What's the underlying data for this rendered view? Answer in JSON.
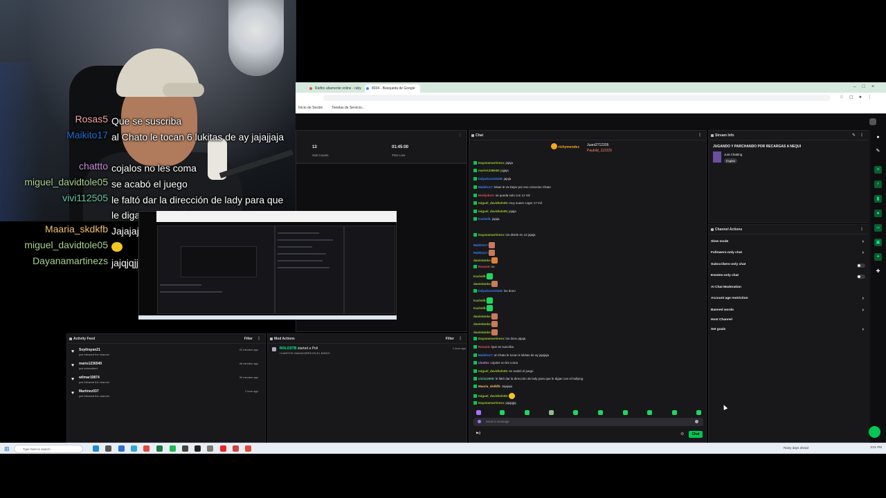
{
  "overlay_chat": [
    {
      "name": "Rosas5",
      "color": "#f5a3a3",
      "message": "Que se suscriba",
      "wrap": false
    },
    {
      "name": "Maikito17",
      "color": "#1f6fd1",
      "message": "al Chato le tocan 6 lukitas de ay jajajjaja",
      "wrap": true
    },
    {
      "name": "chattto",
      "color": "#c78ad9",
      "message": "cojalos no les coma",
      "wrap": false
    },
    {
      "name": "miguel_davidtole05",
      "color": "#a9d08e",
      "message": "se acabó el juego",
      "wrap": false
    },
    {
      "name": "vivi112505",
      "color": "#68c6a0",
      "message": "le faltó dar la dirección de lady para que le digan con el bullying",
      "wrap": true
    },
    {
      "name": "Maaria_skdkfb",
      "color": "#f4c06e",
      "message": "Jajajaja",
      "wrap": false
    },
    {
      "name": "miguel_davidtole05",
      "color": "#a9d08e",
      "message": "",
      "emote": true,
      "wrap": false
    },
    {
      "name": "Dayanamartinezs",
      "color": "#a9d08e",
      "message": "jajqjqjjq",
      "wrap": false
    }
  ],
  "browser": {
    "tabs": [
      "Rañito altamente online - ruby",
      "8034 - Búsqueda de Google"
    ],
    "bookmarks": [
      "Inicio de Sesión",
      "Tiendas de Servicio..."
    ]
  },
  "stats": {
    "subs_value": "13",
    "subs_label": "Sub Counts",
    "time_value": "01:45:00",
    "time_label": "Time Live"
  },
  "activity_feed": {
    "title": "Activity Feed",
    "filter": "Filter",
    "items": [
      {
        "name": "Soyilrayan21",
        "sub": "just followed the channel",
        "time": "22 minutes ago"
      },
      {
        "name": "mario1236549",
        "sub": "just subscribed",
        "time": "46 minutes ago"
      },
      {
        "name": "wilmar10874",
        "sub": "just followed the channel",
        "time": "30 minutes ago"
      },
      {
        "name": "Martinez037",
        "sub": "just followed the channel",
        "time": "1 hour ago"
      }
    ]
  },
  "mod_actions": {
    "title": "Mod Actions",
    "filter": "Filter",
    "item_user": "ROLOSTB",
    "item_action": "started a Poll",
    "item_sub": "CUANTOS GANADORES EN EL BINGO",
    "item_time": "1 hour ago"
  },
  "chat": {
    "title": "Chat",
    "pinned_top": "richymendez",
    "pinned_users": [
      "Juani2712205",
      "Paubild_112329"
    ],
    "input_placeholder": "Send a message",
    "send_label": "Chat",
    "points": "0",
    "lines": [
      {
        "name": "Dayanamartinezs:",
        "color": "#9acd32",
        "text": "jajaja"
      },
      {
        "name": "mario1236549:",
        "color": "#9acd32",
        "text": "jajjaja"
      },
      {
        "name": "ladyalvarez0428:",
        "color": "#3b82f6",
        "text": "jajaja"
      },
      {
        "name": "Maikito17:",
        "color": "#3b82f6",
        "text": "lukas le va Dejar por eso conocios Chato"
      },
      {
        "name": "Heidyduro:",
        "color": "#e05555",
        "text": "se queda solo con 12 mil"
      },
      {
        "name": "miguel_davidtole05:",
        "color": "#9acd32",
        "text": "muy suave coger 17 mil"
      },
      {
        "name": "miguel_davidtole05:",
        "color": "#9acd32",
        "text": "jajaja"
      },
      {
        "name": "Kachelb:",
        "color": "#3b82f6",
        "text": "jajaja"
      },
      {
        "name": "Dayanamartinezs:",
        "color": "#9acd32",
        "text": "los divide en 12 jajaja"
      },
      {
        "name": "Rosas5:",
        "color": "#e05555",
        "text": "no"
      },
      {
        "name": "ladyalvarez0428:",
        "color": "#3b82f6",
        "text": "los dono"
      },
      {
        "name": "Dayanamartinezs:",
        "color": "#9acd32",
        "text": "los dono jajaja"
      },
      {
        "name": "Rosas5:",
        "color": "#e05555",
        "text": "Que se suscriba"
      },
      {
        "name": "Maikito17:",
        "color": "#3b82f6",
        "text": "al Chato le tocan 6 lukitas de ay jajajaja"
      },
      {
        "name": "chattto:",
        "color": "#c78ad9",
        "text": "cojalos no les coma"
      },
      {
        "name": "miguel_davidtole05:",
        "color": "#9acd32",
        "text": "se acabó el juego"
      },
      {
        "name": "vivi112505:",
        "color": "#68c6a0",
        "text": "le faltó dar la dirección de lady para que le digan con el bullying"
      },
      {
        "name": "Maaria_skdkfb:",
        "color": "#f4c06e",
        "text": "Jajajaja"
      },
      {
        "name": "miguel_davidtole05:",
        "color": "#9acd32",
        "text": ""
      },
      {
        "name": "Dayanamartinezs:",
        "color": "#9acd32",
        "text": "jajqjqjjq"
      }
    ]
  },
  "stream_info": {
    "title": "Stream Info",
    "stream_title": "JUGANDO Y PARCHANDO POR RECARGAS A NEQUI",
    "category": "Just Chatting",
    "tag": "English"
  },
  "channel_actions": {
    "title": "Channel Actions",
    "items": [
      {
        "label": "Slow mode",
        "control": "chevron"
      },
      {
        "label": "Followers-only chat",
        "control": "chevron"
      },
      {
        "label": "Subscribers-only chat",
        "control": "toggle"
      },
      {
        "label": "Emotes-only chat",
        "control": "toggle"
      },
      {
        "label": "AI Chat Moderation",
        "control": "none"
      },
      {
        "label": "Account age restriction",
        "control": "chevron"
      },
      {
        "label": "Banned words",
        "control": "chevron"
      },
      {
        "label": "Host Channel",
        "control": "none"
      },
      {
        "label": "Set goals",
        "control": "chevron"
      }
    ]
  },
  "taskbar": {
    "search_placeholder": "Type here to search",
    "weather": "Rainy days ahead",
    "clock": "3:01 PM"
  },
  "colors": {
    "accent_green": "#00c853",
    "panel_bg": "#18181b"
  }
}
